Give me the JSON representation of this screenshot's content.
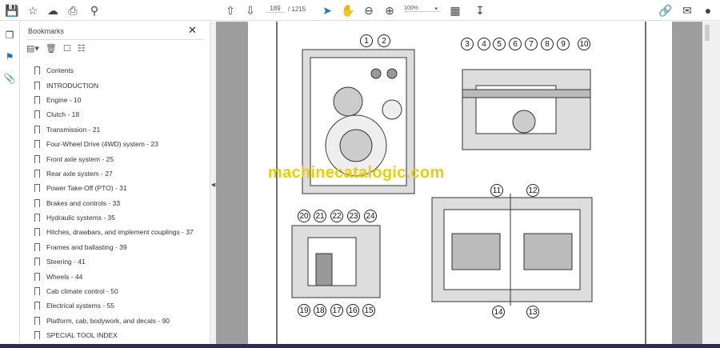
{
  "toolbar": {
    "page_current": "189",
    "page_total": "/ 1215",
    "zoom": "100%"
  },
  "bookmarks": {
    "title": "Bookmarks",
    "items": [
      "Contents",
      "INTRODUCTION",
      "Engine - 10",
      "Clutch - 18",
      "Transmission - 21",
      "Four-Wheel Drive (4WD) system - 23",
      "Front axle system - 25",
      "Rear axle system - 27",
      "Power Take-Off (PTO) - 31",
      "Brakes and controls - 33",
      "Hydraulic systems - 35",
      "Hitches, drawbars, and implement couplings - 37",
      "Frames and ballasting - 39",
      "Steering - 41",
      "Wheels - 44",
      "Cab climate control - 50",
      "Electrical systems - 55",
      "Platform, cab, bodywork, and decals - 90",
      "SPECIAL TOOL INDEX"
    ]
  },
  "document": {
    "watermark": "machinecatalogic.com",
    "callouts": [
      "1",
      "2",
      "3",
      "4",
      "5",
      "6",
      "7",
      "8",
      "9",
      "10",
      "11",
      "12",
      "13",
      "14",
      "15",
      "16",
      "17",
      "18",
      "19",
      "20",
      "21",
      "22",
      "23",
      "24"
    ]
  },
  "colors": {
    "accent": "#1473e6",
    "watermark": "#e8d000",
    "doc_bg": "#9e9e9e"
  }
}
